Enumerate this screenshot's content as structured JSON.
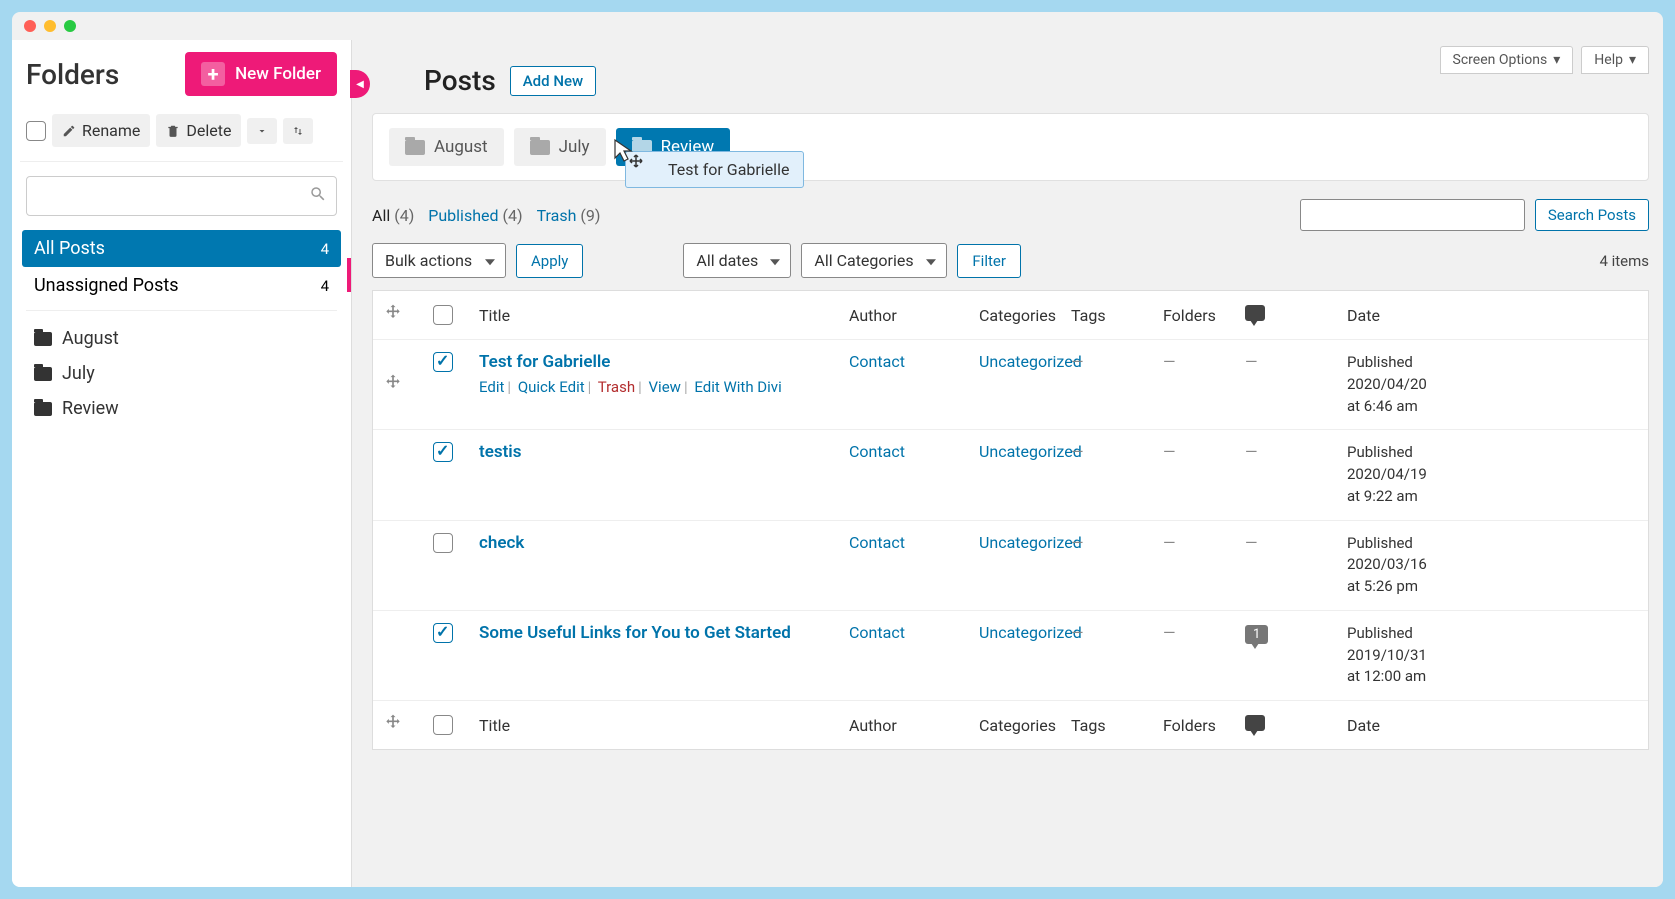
{
  "sidebar": {
    "title": "Folders",
    "new_folder_label": "New Folder",
    "rename_label": "Rename",
    "delete_label": "Delete",
    "folders_nav": [
      {
        "label": "All Posts",
        "count": "4",
        "active": true
      },
      {
        "label": "Unassigned Posts",
        "count": "4",
        "active": false
      }
    ],
    "folder_tree": [
      {
        "label": "August"
      },
      {
        "label": "July"
      },
      {
        "label": "Review"
      }
    ]
  },
  "top_tools": {
    "screen_options": "Screen Options",
    "help": "Help"
  },
  "page": {
    "title": "Posts",
    "add_new": "Add New"
  },
  "folder_tabs": [
    {
      "label": "August",
      "active": false
    },
    {
      "label": "July",
      "active": false
    },
    {
      "label": "Review",
      "active": true
    }
  ],
  "drag_badge": "Test for Gabrielle",
  "status_filters": {
    "all_label": "All",
    "all_count": "(4)",
    "published_label": "Published",
    "published_count": "(4)",
    "trash_label": "Trash",
    "trash_count": "(9)"
  },
  "search_posts_btn": "Search Posts",
  "bulk_actions": "Bulk actions",
  "apply_btn": "Apply",
  "all_dates": "All dates",
  "all_categories": "All Categories",
  "filter_btn": "Filter",
  "items_count": "4 items",
  "columns": {
    "title": "Title",
    "author": "Author",
    "categories": "Categories",
    "tags": "Tags",
    "folders": "Folders",
    "date": "Date"
  },
  "row_actions": {
    "edit": "Edit",
    "quick_edit": "Quick Edit",
    "trash": "Trash",
    "view": "View",
    "edit_divi": "Edit With Divi"
  },
  "posts": [
    {
      "checked": true,
      "title": "Test for Gabrielle",
      "author": "Contact",
      "category": "Uncategorized",
      "tags": "—",
      "folders": "—",
      "comments": "—",
      "status": "Published",
      "date": "2020/04/20",
      "time": "at 6:46 am",
      "show_actions": true,
      "show_drag": true
    },
    {
      "checked": true,
      "title": "testis",
      "author": "Contact",
      "category": "Uncategorized",
      "tags": "—",
      "folders": "—",
      "comments": "—",
      "status": "Published",
      "date": "2020/04/19",
      "time": "at 9:22 am",
      "show_actions": false,
      "show_drag": false
    },
    {
      "checked": false,
      "title": "check",
      "author": "Contact",
      "category": "Uncategorized",
      "tags": "—",
      "folders": "—",
      "comments": "—",
      "status": "Published",
      "date": "2020/03/16",
      "time": "at 5:26 pm",
      "show_actions": false,
      "show_drag": false
    },
    {
      "checked": true,
      "title": "Some Useful Links for You to Get Started",
      "author": "Contact",
      "category": "Uncategorized",
      "tags": "—",
      "folders": "—",
      "comments": "1",
      "status": "Published",
      "date": "2019/10/31",
      "time": "at 12:00 am",
      "show_actions": false,
      "show_drag": false
    }
  ]
}
